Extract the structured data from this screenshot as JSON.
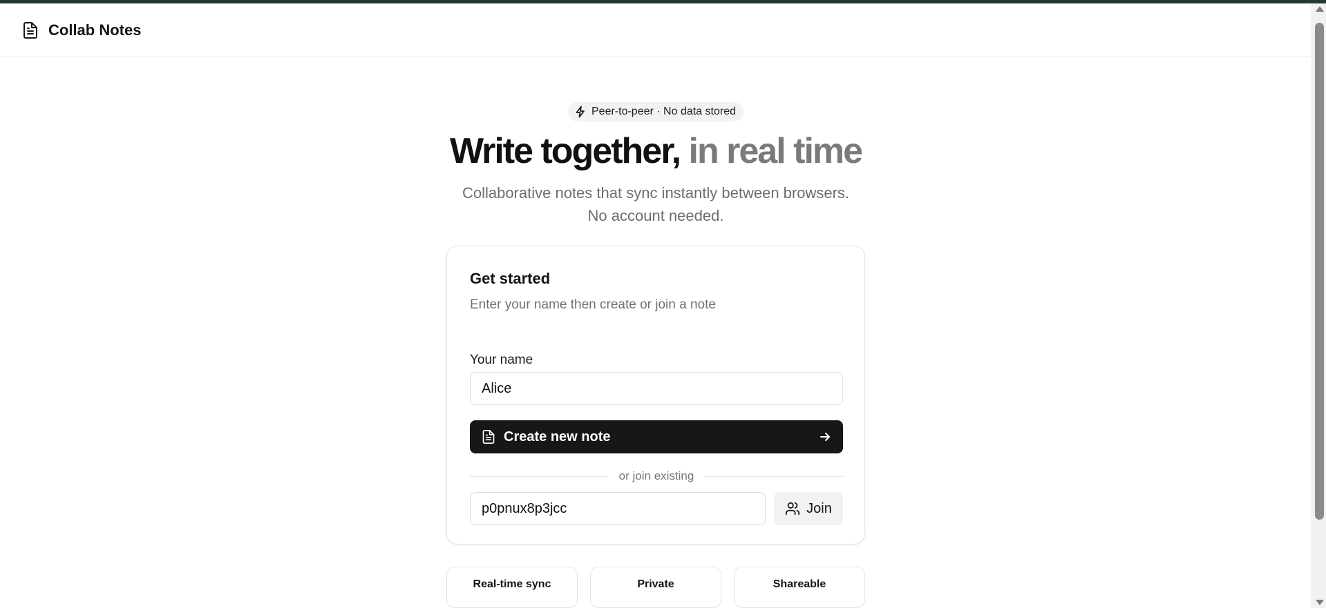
{
  "header": {
    "brand": "Collab Notes",
    "brand_icon": "document-icon"
  },
  "hero": {
    "badge_icon": "lightning-bolt-icon",
    "badge": "Peer-to-peer · No data stored",
    "title_main": "Write together,",
    "title_accent": " in real time",
    "subtitle_line1": "Collaborative notes that sync instantly between browsers.",
    "subtitle_line2": "No account needed."
  },
  "card": {
    "title": "Get started",
    "description": "Enter your name then create or join a note",
    "name_label": "Your name",
    "name_value": "Alice",
    "create_button": "Create new note",
    "create_icon": "document-icon",
    "create_arrow_icon": "arrow-right-icon",
    "divider_text": "or join existing",
    "join_code_value": "p0pnux8p3jcc",
    "join_button": "Join",
    "join_icon": "users-icon"
  },
  "features": [
    {
      "label": "Real-time sync"
    },
    {
      "label": "Private"
    },
    {
      "label": "Shareable"
    }
  ],
  "colors": {
    "primary_button": "#171717",
    "muted_text": "#7a7a7a",
    "top_strip": "#263535"
  }
}
